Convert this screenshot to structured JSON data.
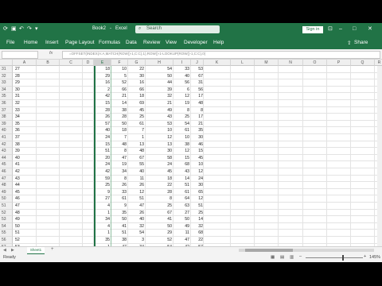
{
  "title_bar": {
    "workbook": "Book2",
    "app": "Excel",
    "search_placeholder": "Search",
    "sign_in": "Sign in"
  },
  "ribbon": {
    "tabs": [
      "File",
      "Home",
      "Insert",
      "Page Layout",
      "Formulas",
      "Data",
      "Review",
      "View",
      "Developer",
      "Help"
    ],
    "share": "Share"
  },
  "formula_bar": {
    "fx": "fx",
    "formula": "=OFFSET(INDEX(A:A,MATCH(ROW()-1,C:C),1),ROW()-1-LOOKUP(ROW()-1,C:C),0)"
  },
  "sheet": {
    "columns": [
      "A",
      "B",
      "C",
      "D",
      "E",
      "F",
      "G",
      "H",
      "I",
      "J",
      "K",
      "L",
      "M",
      "N",
      "O",
      "P",
      "Q",
      "R"
    ],
    "selected_column": "E",
    "rows": [
      {
        "r": "31",
        "a": "27",
        "e": "18",
        "f": "10",
        "g": "22",
        "h": "54",
        "i": "33",
        "j": "53"
      },
      {
        "r": "32",
        "a": "28",
        "e": "29",
        "f": "5",
        "g": "30",
        "h": "50",
        "i": "40",
        "j": "67"
      },
      {
        "r": "33",
        "a": "29",
        "e": "16",
        "f": "52",
        "g": "16",
        "h": "44",
        "i": "56",
        "j": "31"
      },
      {
        "r": "34",
        "a": "30",
        "e": "2",
        "f": "66",
        "g": "66",
        "h": "39",
        "i": "6",
        "j": "56"
      },
      {
        "r": "35",
        "a": "31",
        "e": "42",
        "f": "21",
        "g": "18",
        "h": "32",
        "i": "12",
        "j": "17"
      },
      {
        "r": "36",
        "a": "32",
        "e": "15",
        "f": "14",
        "g": "69",
        "h": "21",
        "i": "19",
        "j": "48"
      },
      {
        "r": "37",
        "a": "33",
        "e": "28",
        "f": "38",
        "g": "45",
        "h": "49",
        "i": "8",
        "j": "8"
      },
      {
        "r": "38",
        "a": "34",
        "e": "26",
        "f": "28",
        "g": "25",
        "h": "43",
        "i": "25",
        "j": "17"
      },
      {
        "r": "39",
        "a": "35",
        "e": "57",
        "f": "50",
        "g": "61",
        "h": "53",
        "i": "54",
        "j": "21"
      },
      {
        "r": "40",
        "a": "36",
        "e": "40",
        "f": "18",
        "g": "7",
        "h": "10",
        "i": "61",
        "j": "35"
      },
      {
        "r": "41",
        "a": "37",
        "e": "24",
        "f": "7",
        "g": "1",
        "h": "12",
        "i": "10",
        "j": "30"
      },
      {
        "r": "42",
        "a": "38",
        "e": "15",
        "f": "48",
        "g": "13",
        "h": "13",
        "i": "38",
        "j": "46"
      },
      {
        "r": "43",
        "a": "39",
        "e": "51",
        "f": "8",
        "g": "48",
        "h": "30",
        "i": "12",
        "j": "15"
      },
      {
        "r": "44",
        "a": "40",
        "e": "20",
        "f": "47",
        "g": "67",
        "h": "58",
        "i": "15",
        "j": "45"
      },
      {
        "r": "45",
        "a": "41",
        "e": "24",
        "f": "19",
        "g": "55",
        "h": "24",
        "i": "68",
        "j": "10"
      },
      {
        "r": "46",
        "a": "42",
        "e": "42",
        "f": "34",
        "g": "40",
        "h": "45",
        "i": "43",
        "j": "12"
      },
      {
        "r": "47",
        "a": "43",
        "e": "59",
        "f": "8",
        "g": "11",
        "h": "18",
        "i": "14",
        "j": "24"
      },
      {
        "r": "48",
        "a": "44",
        "e": "25",
        "f": "26",
        "g": "26",
        "h": "22",
        "i": "51",
        "j": "30"
      },
      {
        "r": "49",
        "a": "45",
        "e": "9",
        "f": "33",
        "g": "12",
        "h": "28",
        "i": "61",
        "j": "65"
      },
      {
        "r": "50",
        "a": "46",
        "e": "27",
        "f": "61",
        "g": "51",
        "h": "8",
        "i": "64",
        "j": "12"
      },
      {
        "r": "51",
        "a": "47",
        "e": "4",
        "f": "9",
        "g": "47",
        "h": "25",
        "i": "63",
        "j": "51"
      },
      {
        "r": "52",
        "a": "48",
        "e": "1",
        "f": "35",
        "g": "26",
        "h": "67",
        "i": "27",
        "j": "25"
      },
      {
        "r": "53",
        "a": "49",
        "e": "34",
        "f": "50",
        "g": "40",
        "h": "41",
        "i": "50",
        "j": "14"
      },
      {
        "r": "54",
        "a": "50",
        "e": "4",
        "f": "41",
        "g": "32",
        "h": "50",
        "i": "49",
        "j": "32"
      },
      {
        "r": "55",
        "a": "51",
        "e": "1",
        "f": "51",
        "g": "54",
        "h": "29",
        "i": "11",
        "j": "68"
      },
      {
        "r": "56",
        "a": "52",
        "e": "35",
        "f": "38",
        "g": "3",
        "h": "52",
        "i": "47",
        "j": "22"
      },
      {
        "r": "57",
        "a": "53",
        "e": "1",
        "f": "47",
        "g": "34",
        "h": "54",
        "i": "42",
        "j": "57"
      }
    ]
  },
  "sheet_tabs": {
    "active": "Sheet1",
    "add": "+"
  },
  "status": {
    "ready": "Ready",
    "zoom": "145%"
  },
  "colors": {
    "accent": "#217346"
  }
}
